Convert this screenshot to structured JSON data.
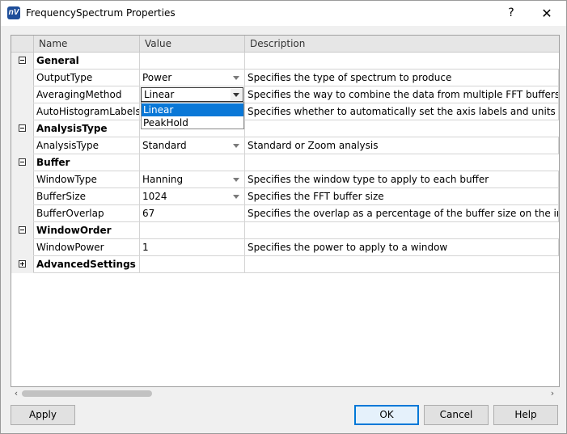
{
  "window": {
    "title": "FrequencySpectrum Properties",
    "help_glyph": "?",
    "close_glyph": "✕",
    "app_icon_text": "nV"
  },
  "grid": {
    "columns": [
      "Name",
      "Value",
      "Description"
    ],
    "rows": [
      {
        "type": "category",
        "name": "General",
        "expanded": true
      },
      {
        "type": "property",
        "name": "OutputType",
        "value": "Power",
        "has_dropdown": true,
        "description": "Specifies the type of spectrum to produce"
      },
      {
        "type": "property",
        "name": "AveragingMethod",
        "value": "Linear",
        "editing": true,
        "description": "Specifies the way to combine the data from multiple FFT buffers"
      },
      {
        "type": "property",
        "name": "AutoHistogramLabels",
        "value": "",
        "description": "Specifies whether to automatically set the axis labels and units text or"
      },
      {
        "type": "category",
        "name": "AnalysisType",
        "expanded": true
      },
      {
        "type": "property",
        "name": "AnalysisType",
        "value": "Standard",
        "has_dropdown": true,
        "description": "Standard or Zoom analysis"
      },
      {
        "type": "category",
        "name": "Buffer",
        "expanded": true
      },
      {
        "type": "property",
        "name": "WindowType",
        "value": "Hanning",
        "has_dropdown": true,
        "description": "Specifies the window type to apply to each buffer"
      },
      {
        "type": "property",
        "name": "BufferSize",
        "value": "1024",
        "has_dropdown": true,
        "description": "Specifies the FFT buffer size"
      },
      {
        "type": "property",
        "name": "BufferOverlap",
        "value": "67",
        "description": "Specifies the overlap as a percentage of the buffer size on the input d"
      },
      {
        "type": "category",
        "name": "WindowOrder",
        "expanded": true
      },
      {
        "type": "property",
        "name": "WindowPower",
        "value": "1",
        "description": "Specifies the power to apply to a window"
      },
      {
        "type": "category",
        "name": "AdvancedSettings",
        "expanded": false
      }
    ]
  },
  "dropdown": {
    "options": [
      "Linear",
      "PeakHold"
    ],
    "selected": "Linear"
  },
  "buttons": {
    "apply": "Apply",
    "ok": "OK",
    "cancel": "Cancel",
    "help": "Help"
  },
  "scrollbar": {
    "left_arrow": "‹",
    "right_arrow": "›"
  },
  "colors": {
    "selection": "#0a78d7",
    "default_button_border": "#0078d7"
  }
}
